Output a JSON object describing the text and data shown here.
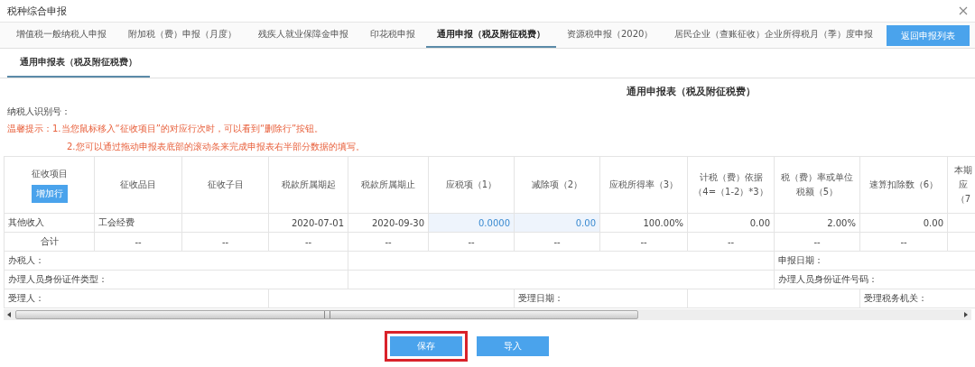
{
  "window": {
    "title": "税种综合申报"
  },
  "tabs": [
    {
      "label": "增值税一般纳税人申报",
      "selected": false
    },
    {
      "label": "附加税（费）申报（月度）",
      "selected": false
    },
    {
      "label": "残疾人就业保障金申报",
      "selected": false
    },
    {
      "label": "印花税申报",
      "selected": false
    },
    {
      "label": "通用申报（税及附征税费）",
      "selected": true
    },
    {
      "label": "资源税申报（2020）",
      "selected": false
    },
    {
      "label": "居民企业（查账征收）企业所得税月（季）度申报",
      "selected": false
    }
  ],
  "return_button": "返回申报列表",
  "subtabs": [
    {
      "label": "通用申报表（税及附征税费）",
      "selected": true
    }
  ],
  "form_title": "通用申报表（税及附征税费）",
  "taxpayer_id_label": "纳税人识别号：",
  "hint": {
    "label": "温馨提示：",
    "lines": [
      "1.当您鼠标移入“征收项目”的对应行次时，可以看到“删除行”按钮。",
      "2.您可以通过拖动申报表底部的滚动条来完成申报表右半部分数据的填写。"
    ]
  },
  "table": {
    "columns": [
      "征收项目",
      "征收品目",
      "征收子目",
      "税款所属期起",
      "税款所属期止",
      "应税项（1）",
      "减除项（2）",
      "应税所得率（3）",
      "计税（费）依据（4=（1-2）*3）",
      "税（费）率或单位税额（5）",
      "速算扣除数（6）",
      "本期应（7"
    ],
    "add_row_button": "增加行",
    "rows": [
      {
        "kind": "data",
        "cells": [
          {
            "text": "其他收入",
            "editable": false
          },
          {
            "text": "工会经费",
            "editable": false
          },
          {
            "editable": false
          },
          {
            "text": "2020-07-01",
            "editable": false
          },
          {
            "text": "2020-09-30",
            "editable": false
          },
          {
            "text": "0.0000",
            "editable": true
          },
          {
            "text": "0.00",
            "editable": true
          },
          {
            "text": "100.00%",
            "editable": false
          },
          {
            "text": "0.00",
            "editable": false
          },
          {
            "text": "2.00%",
            "editable": false
          },
          {
            "text": "0.00",
            "editable": false
          },
          {
            "editable": false
          }
        ]
      },
      {
        "kind": "total",
        "cells": [
          {
            "text": "合计",
            "editable": false
          },
          {
            "text": "--",
            "editable": false
          },
          {
            "text": "--",
            "editable": false
          },
          {
            "text": "--",
            "editable": false
          },
          {
            "text": "--",
            "editable": false
          },
          {
            "text": "--",
            "editable": false
          },
          {
            "text": "--",
            "editable": false
          },
          {
            "text": "--",
            "editable": false
          },
          {
            "text": "--",
            "editable": false
          },
          {
            "text": "--",
            "editable": false
          },
          {
            "text": "--",
            "editable": false
          },
          {
            "editable": false
          }
        ]
      }
    ],
    "footer_rows": [
      [
        "办税人：",
        "申报日期："
      ],
      [
        "办理人员身份证件类型：",
        "办理人员身份证件号码："
      ],
      [
        "受理人：",
        "受理日期：",
        "受理税务机关："
      ]
    ]
  },
  "buttons": [
    {
      "label": "保存",
      "highlighted": true
    },
    {
      "label": "导入",
      "highlighted": false
    }
  ]
}
